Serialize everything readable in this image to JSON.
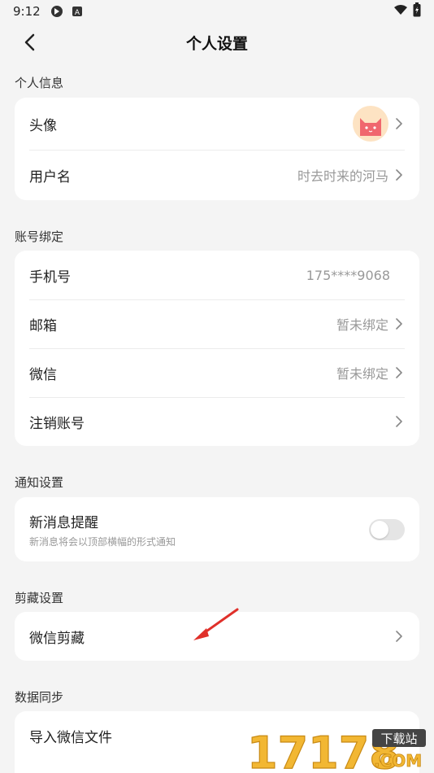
{
  "status_bar": {
    "time": "9:12"
  },
  "header": {
    "title": "个人设置"
  },
  "sections": {
    "profile": {
      "label": "个人信息",
      "avatar_label": "头像",
      "username_label": "用户名",
      "username_value": "时去时来的河马"
    },
    "account": {
      "label": "账号绑定",
      "phone_label": "手机号",
      "phone_value": "175****9068",
      "email_label": "邮箱",
      "email_value": "暂未绑定",
      "wechat_label": "微信",
      "wechat_value": "暂未绑定",
      "delete_label": "注销账号"
    },
    "notify": {
      "label": "通知设置",
      "new_msg_label": "新消息提醒",
      "new_msg_desc": "新消息将会以顶部横幅的形式通知",
      "toggle_on": false
    },
    "clip": {
      "label": "剪藏设置",
      "wechat_clip_label": "微信剪藏"
    },
    "sync": {
      "label": "数据同步",
      "import_label": "导入微信文件"
    }
  },
  "watermark": {
    "text": "17178",
    "badge": "下载站",
    "suffix": ".COM"
  },
  "colors": {
    "accent_arrow": "#e0302a",
    "avatar_bg": "#fde3c3",
    "cat": "#f0676e",
    "watermark": "#f2b733"
  }
}
